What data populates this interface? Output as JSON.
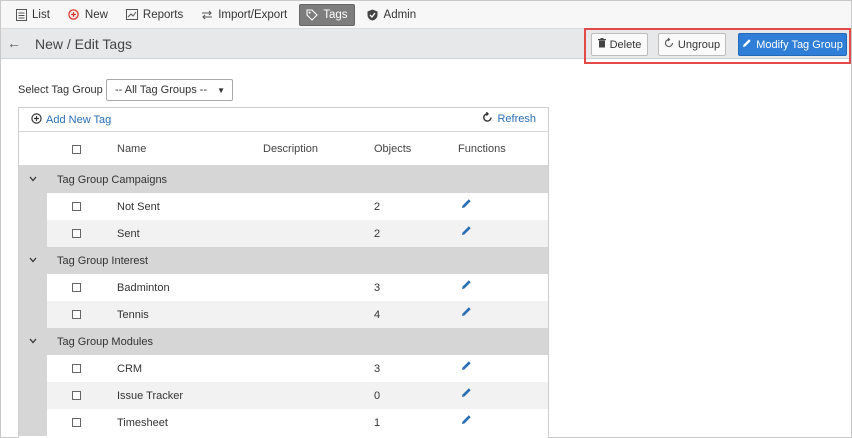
{
  "nav": {
    "items": [
      {
        "label": "List",
        "icon": "list-icon",
        "active": false
      },
      {
        "label": "New",
        "icon": "plus-circle-icon",
        "active": false
      },
      {
        "label": "Reports",
        "icon": "chart-icon",
        "active": false
      },
      {
        "label": "Import/Export",
        "icon": "import-export-icon",
        "active": false
      },
      {
        "label": "Tags",
        "icon": "tag-icon",
        "active": true
      },
      {
        "label": "Admin",
        "icon": "shield-check-icon",
        "active": false
      }
    ]
  },
  "header": {
    "title": "New / Edit Tags",
    "delete_label": "Delete",
    "ungroup_label": "Ungroup",
    "modify_label": "Modify Tag Group"
  },
  "filter": {
    "label": "Select Tag Group",
    "selected": "-- All Tag Groups --"
  },
  "grid": {
    "add_label": "Add New Tag",
    "refresh_label": "Refresh",
    "columns": [
      "Name",
      "Description",
      "Objects",
      "Functions"
    ],
    "groups": [
      {
        "label": "Tag Group Campaigns",
        "rows": [
          {
            "name": "Not Sent",
            "objects": "2"
          },
          {
            "name": "Sent",
            "objects": "2"
          }
        ]
      },
      {
        "label": "Tag Group Interest",
        "rows": [
          {
            "name": "Badminton",
            "objects": "3"
          },
          {
            "name": "Tennis",
            "objects": "4"
          }
        ]
      },
      {
        "label": "Tag Group Modules",
        "rows": [
          {
            "name": "CRM",
            "objects": "3"
          },
          {
            "name": "Issue Tracker",
            "objects": "0"
          },
          {
            "name": "Timesheet",
            "objects": "1"
          }
        ]
      }
    ]
  },
  "colors": {
    "accent": "#2f7ed8",
    "highlight": "#e34a47",
    "group_row": "#d6d6d6"
  }
}
